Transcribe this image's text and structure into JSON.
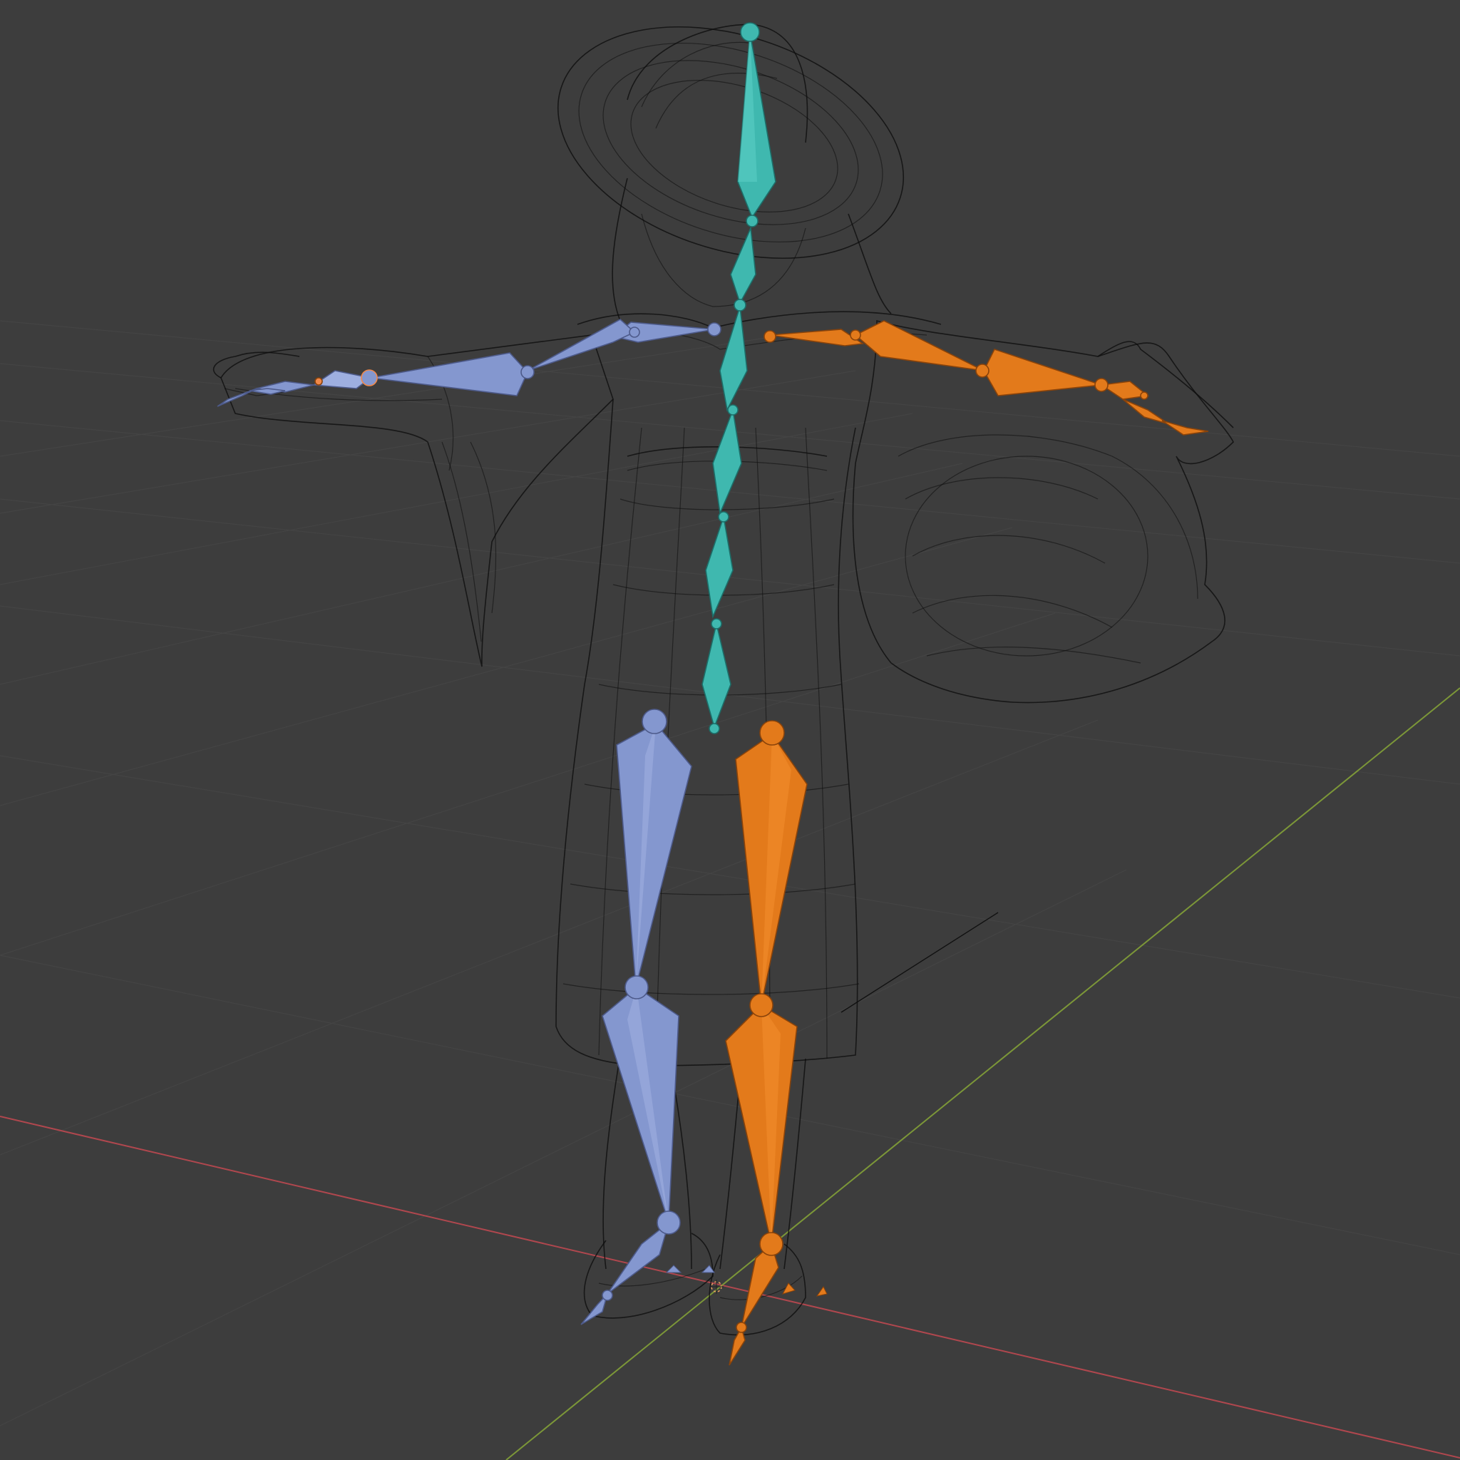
{
  "viewport": {
    "mode": "wireframe",
    "background": "#3d3d3d",
    "grid": true,
    "grid_color": "#4b4b4b",
    "x_axis_color": "#b0474e",
    "y_axis_color": "#7c9738"
  },
  "mesh": {
    "kind": "character",
    "wire_color": "#0d0d0d"
  },
  "armature": {
    "bone_display": "octahedral",
    "groups": [
      {
        "side": "center",
        "bones": "spine-head",
        "color": "#3fb8af",
        "edge": "#1d6e69"
      },
      {
        "side": "left",
        "bones": "arm-leg",
        "color": "#8497cf",
        "edge": "#4d5a8a"
      },
      {
        "side": "right",
        "bones": "arm-leg",
        "color": "#e37a1b",
        "edge": "#8a430a"
      }
    ],
    "selected_highlight": "#f0884a"
  }
}
